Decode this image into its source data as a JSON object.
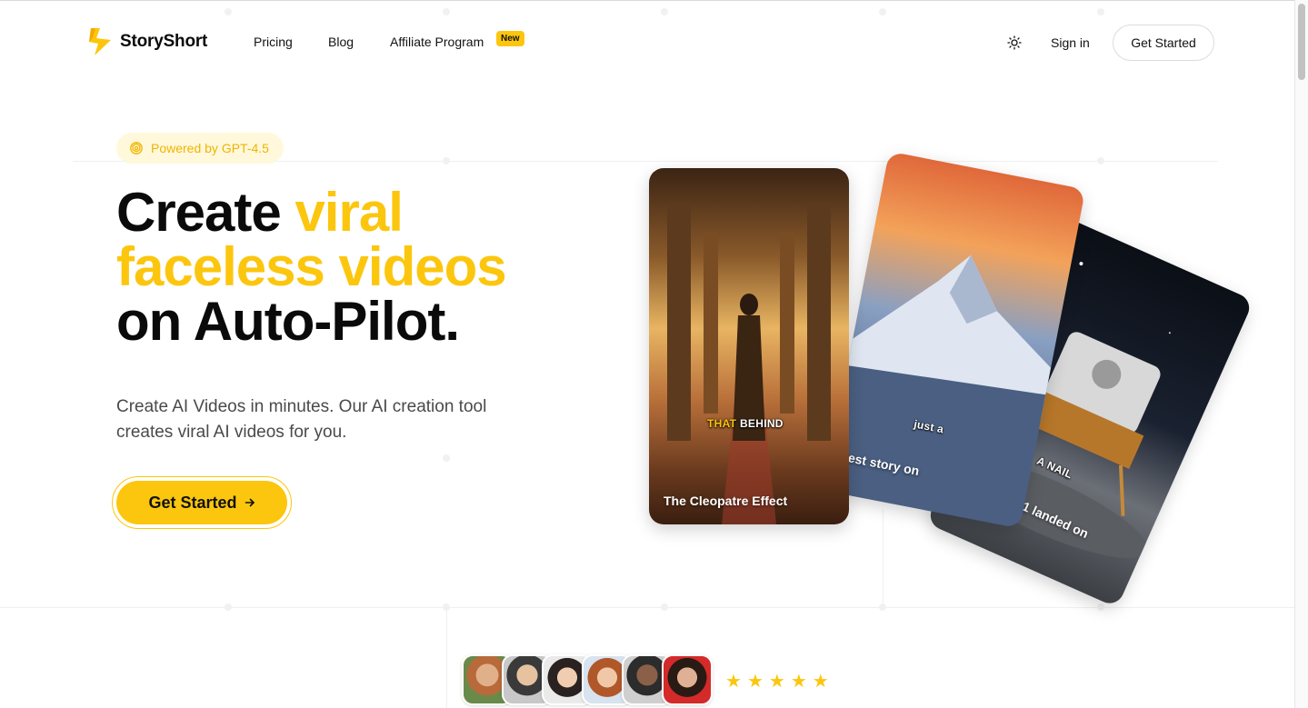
{
  "nav": {
    "brand": "StoryShort",
    "links": [
      {
        "label": "Pricing"
      },
      {
        "label": "Blog"
      },
      {
        "label": "Affiliate Program",
        "badge": "New"
      }
    ],
    "theme_toggle_icon": "sun-icon",
    "sign_in": "Sign in",
    "cta": "Get Started"
  },
  "hero": {
    "powered_by": "Powered by GPT-4.5",
    "headline": {
      "part1": "Create ",
      "highlight1": "viral",
      "highlight2": "faceless videos",
      "part2": "on Auto-Pilot."
    },
    "subtitle": "Create AI Videos in minutes. Our AI creation tool creates viral AI videos for you.",
    "cta": "Get Started",
    "cta_icon": "arrow-right-icon"
  },
  "cards": [
    {
      "caption": "The Cleopatre Effect",
      "overlay_highlight": "THAT",
      "overlay_text": "BEHIND"
    },
    {
      "caption": "sadest story on\nest",
      "overlay_text": "just a"
    },
    {
      "caption": "day Apollo 11 landed on\nmoon",
      "overlay_text": "A NAIL"
    }
  ],
  "social_proof": {
    "avatar_count": 6,
    "rating": 5,
    "star_icon": "star-icon"
  },
  "colors": {
    "accent": "#fcc60e",
    "text": "#0a0a0a",
    "muted": "#4a4a4a"
  }
}
